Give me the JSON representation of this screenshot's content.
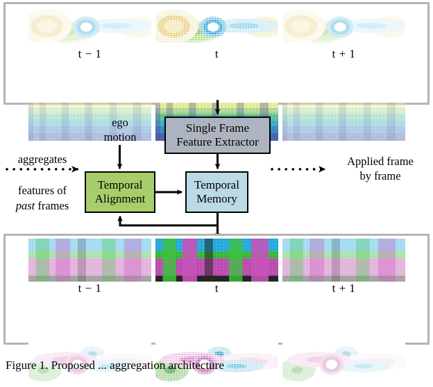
{
  "figure": {
    "caption": "Figure 1.   Proposed ... aggregation architecture"
  },
  "top_panel": {
    "name": "input-frames-panel",
    "frames": [
      {
        "label_prefix": "t",
        "label_op": " − ",
        "label_suffix": "1",
        "label": "t − 1",
        "state": "faded"
      },
      {
        "label_prefix": "t",
        "label_op": "",
        "label_suffix": "",
        "label": "t",
        "state": "current"
      },
      {
        "label_prefix": "t",
        "label_op": " + ",
        "label_suffix": "1",
        "label": "t + 1",
        "state": "faded"
      }
    ],
    "row_top_kind": "lidar-point-cloud-birdseye",
    "row_bottom_kind": "range-image-depth"
  },
  "bottom_panel": {
    "name": "output-frames-panel",
    "frames": [
      {
        "label": "t − 1",
        "state": "faded"
      },
      {
        "label": "t",
        "state": "current"
      },
      {
        "label": "t + 1",
        "state": "faded"
      }
    ],
    "row_top_kind": "range-image-semantic-segmentation",
    "row_bottom_kind": "lidar-point-cloud-birdseye-segmented"
  },
  "diagram": {
    "boxes": [
      {
        "id": "single-frame-feature-extractor",
        "line1": "Single Frame",
        "line2": "Feature Extractor",
        "color": "#adb4bf"
      },
      {
        "id": "temporal-alignment",
        "line1": "Temporal",
        "line2": "Alignment",
        "color": "#a8ce6b"
      },
      {
        "id": "temporal-memory",
        "line1": "Temporal",
        "line2": "Memory",
        "color": "#badae5"
      }
    ],
    "labels": {
      "ego_motion_line1": "ego",
      "ego_motion_line2": "motion",
      "aggregates_line1": "aggregates",
      "aggregates_line2": "features of",
      "aggregates_line3_em": "past",
      "aggregates_line3_rest": " frames",
      "applied_line1": "Applied frame",
      "applied_line2": "by frame"
    },
    "colors": {
      "stroke": "#000000",
      "extractor_fill": "#adb4bf",
      "alignment_fill": "#a8ce6b",
      "memory_fill": "#badae5",
      "panel_border": "#b4b4b4"
    }
  }
}
